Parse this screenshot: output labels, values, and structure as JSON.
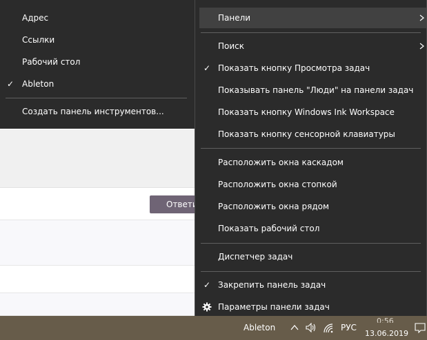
{
  "left_menu": {
    "items": [
      {
        "label": "Адрес",
        "checked": false
      },
      {
        "label": "Ссылки",
        "checked": false
      },
      {
        "label": "Рабочий стол",
        "checked": false
      },
      {
        "label": "Ableton",
        "checked": true
      }
    ],
    "create_toolbar_label": "Создать панель инструментов..."
  },
  "right_menu": {
    "items": [
      {
        "label": "Панели",
        "highlighted": true,
        "submenu": true
      },
      {
        "label": "Поиск",
        "submenu": true
      },
      {
        "label": "Показать кнопку Просмотра задач",
        "checked": true
      },
      {
        "label": "Показывать панель \"Люди\" на панели задач"
      },
      {
        "label": "Показать кнопку Windows Ink Workspace"
      },
      {
        "label": "Показать кнопку сенсорной клавиатуры"
      },
      {
        "label": "Расположить окна каскадом"
      },
      {
        "label": "Расположить окна стопкой"
      },
      {
        "label": "Расположить окна рядом"
      },
      {
        "label": "Показать рабочий стол"
      },
      {
        "label": "Диспетчер задач"
      },
      {
        "label": "Закрепить панель задач",
        "checked": true
      },
      {
        "label": "Параметры панели задач",
        "icon": "gear-icon"
      }
    ]
  },
  "background": {
    "reply_button_label": "Ответи"
  },
  "taskbar": {
    "toolbar_label": "Ableton",
    "language": "РУС",
    "date": "13.06.2019",
    "time_partial": "0:56"
  },
  "colors": {
    "menu_bg": "#2b2b2b",
    "menu_highlight": "#414141",
    "taskbar_bg": "#675c4a",
    "reply_button": "#6f6475"
  }
}
